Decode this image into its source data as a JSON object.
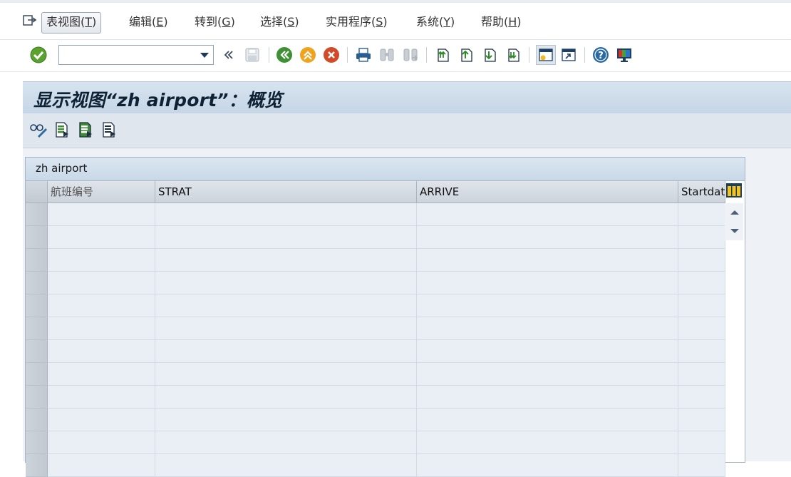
{
  "menu": {
    "items": [
      {
        "label": "表视图(",
        "key": "T",
        "suffix": ")"
      },
      {
        "label": "编辑(",
        "key": "E",
        "suffix": ")"
      },
      {
        "label": "转到(",
        "key": "G",
        "suffix": ")"
      },
      {
        "label": "选择(",
        "key": "S",
        "suffix": ")"
      },
      {
        "label": "实用程序(",
        "key": "S",
        "suffix": ")"
      },
      {
        "label": "系统(",
        "key": "Y",
        "suffix": ")"
      },
      {
        "label": "帮助(",
        "key": "H",
        "suffix": ")"
      }
    ]
  },
  "toolbar": {
    "command_value": "",
    "icons": [
      "enter-icon",
      "command-dropdown-icon",
      "collapse-icon",
      "save-icon",
      "back-icon",
      "exit-icon",
      "cancel-icon",
      "print-icon",
      "find-icon",
      "find-next-icon",
      "first-page-icon",
      "previous-page-icon",
      "next-page-icon",
      "last-page-icon",
      "create-session-icon",
      "shortcut-icon",
      "help-icon",
      "customize-layout-icon"
    ]
  },
  "title": "显示视图“zh airport”：概览",
  "appbar": {
    "icons": [
      "display-change-icon",
      "new-entries-icon",
      "copy-as-icon",
      "delete-icon"
    ]
  },
  "table": {
    "caption": "zh airport",
    "columns": [
      "航班编号",
      "STRAT",
      "ARRIVE",
      "Startdat"
    ],
    "row_count": 12
  },
  "colors": {
    "title_bg": "#c6d6e6",
    "table_cell_bg": "#e9eff5",
    "header_bg": "#cdd4dc"
  }
}
